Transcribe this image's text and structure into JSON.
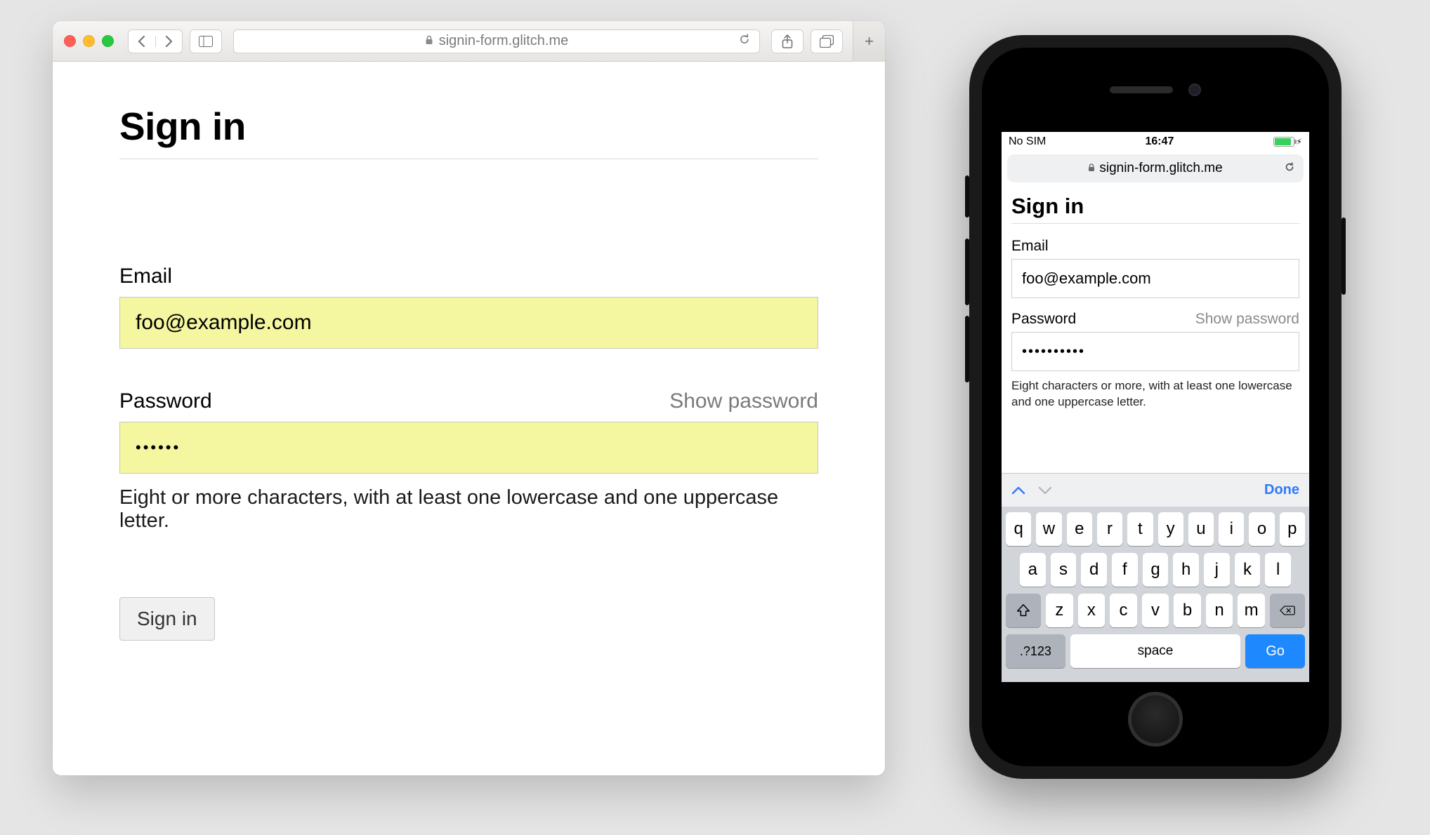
{
  "desktop": {
    "url": "signin-form.glitch.me",
    "page": {
      "title": "Sign in",
      "email_label": "Email",
      "email_value": "foo@example.com",
      "password_label": "Password",
      "show_password": "Show password",
      "password_masked": "••••••",
      "hint": "Eight or more characters, with at least one lowercase and one uppercase letter.",
      "submit": "Sign in"
    }
  },
  "mobile": {
    "status": {
      "carrier": "No SIM",
      "time": "16:47"
    },
    "url": "signin-form.glitch.me",
    "page": {
      "title": "Sign in",
      "email_label": "Email",
      "email_value": "foo@example.com",
      "password_label": "Password",
      "show_password": "Show password",
      "password_masked": "••••••••••",
      "hint": "Eight characters or more, with at least one lowercase and one uppercase letter."
    },
    "keyboard": {
      "done": "Done",
      "row1": [
        "q",
        "w",
        "e",
        "r",
        "t",
        "y",
        "u",
        "i",
        "o",
        "p"
      ],
      "row2": [
        "a",
        "s",
        "d",
        "f",
        "g",
        "h",
        "j",
        "k",
        "l"
      ],
      "row3": [
        "z",
        "x",
        "c",
        "v",
        "b",
        "n",
        "m"
      ],
      "numbers_key": ".?123",
      "space_key": "space",
      "go_key": "Go"
    }
  }
}
